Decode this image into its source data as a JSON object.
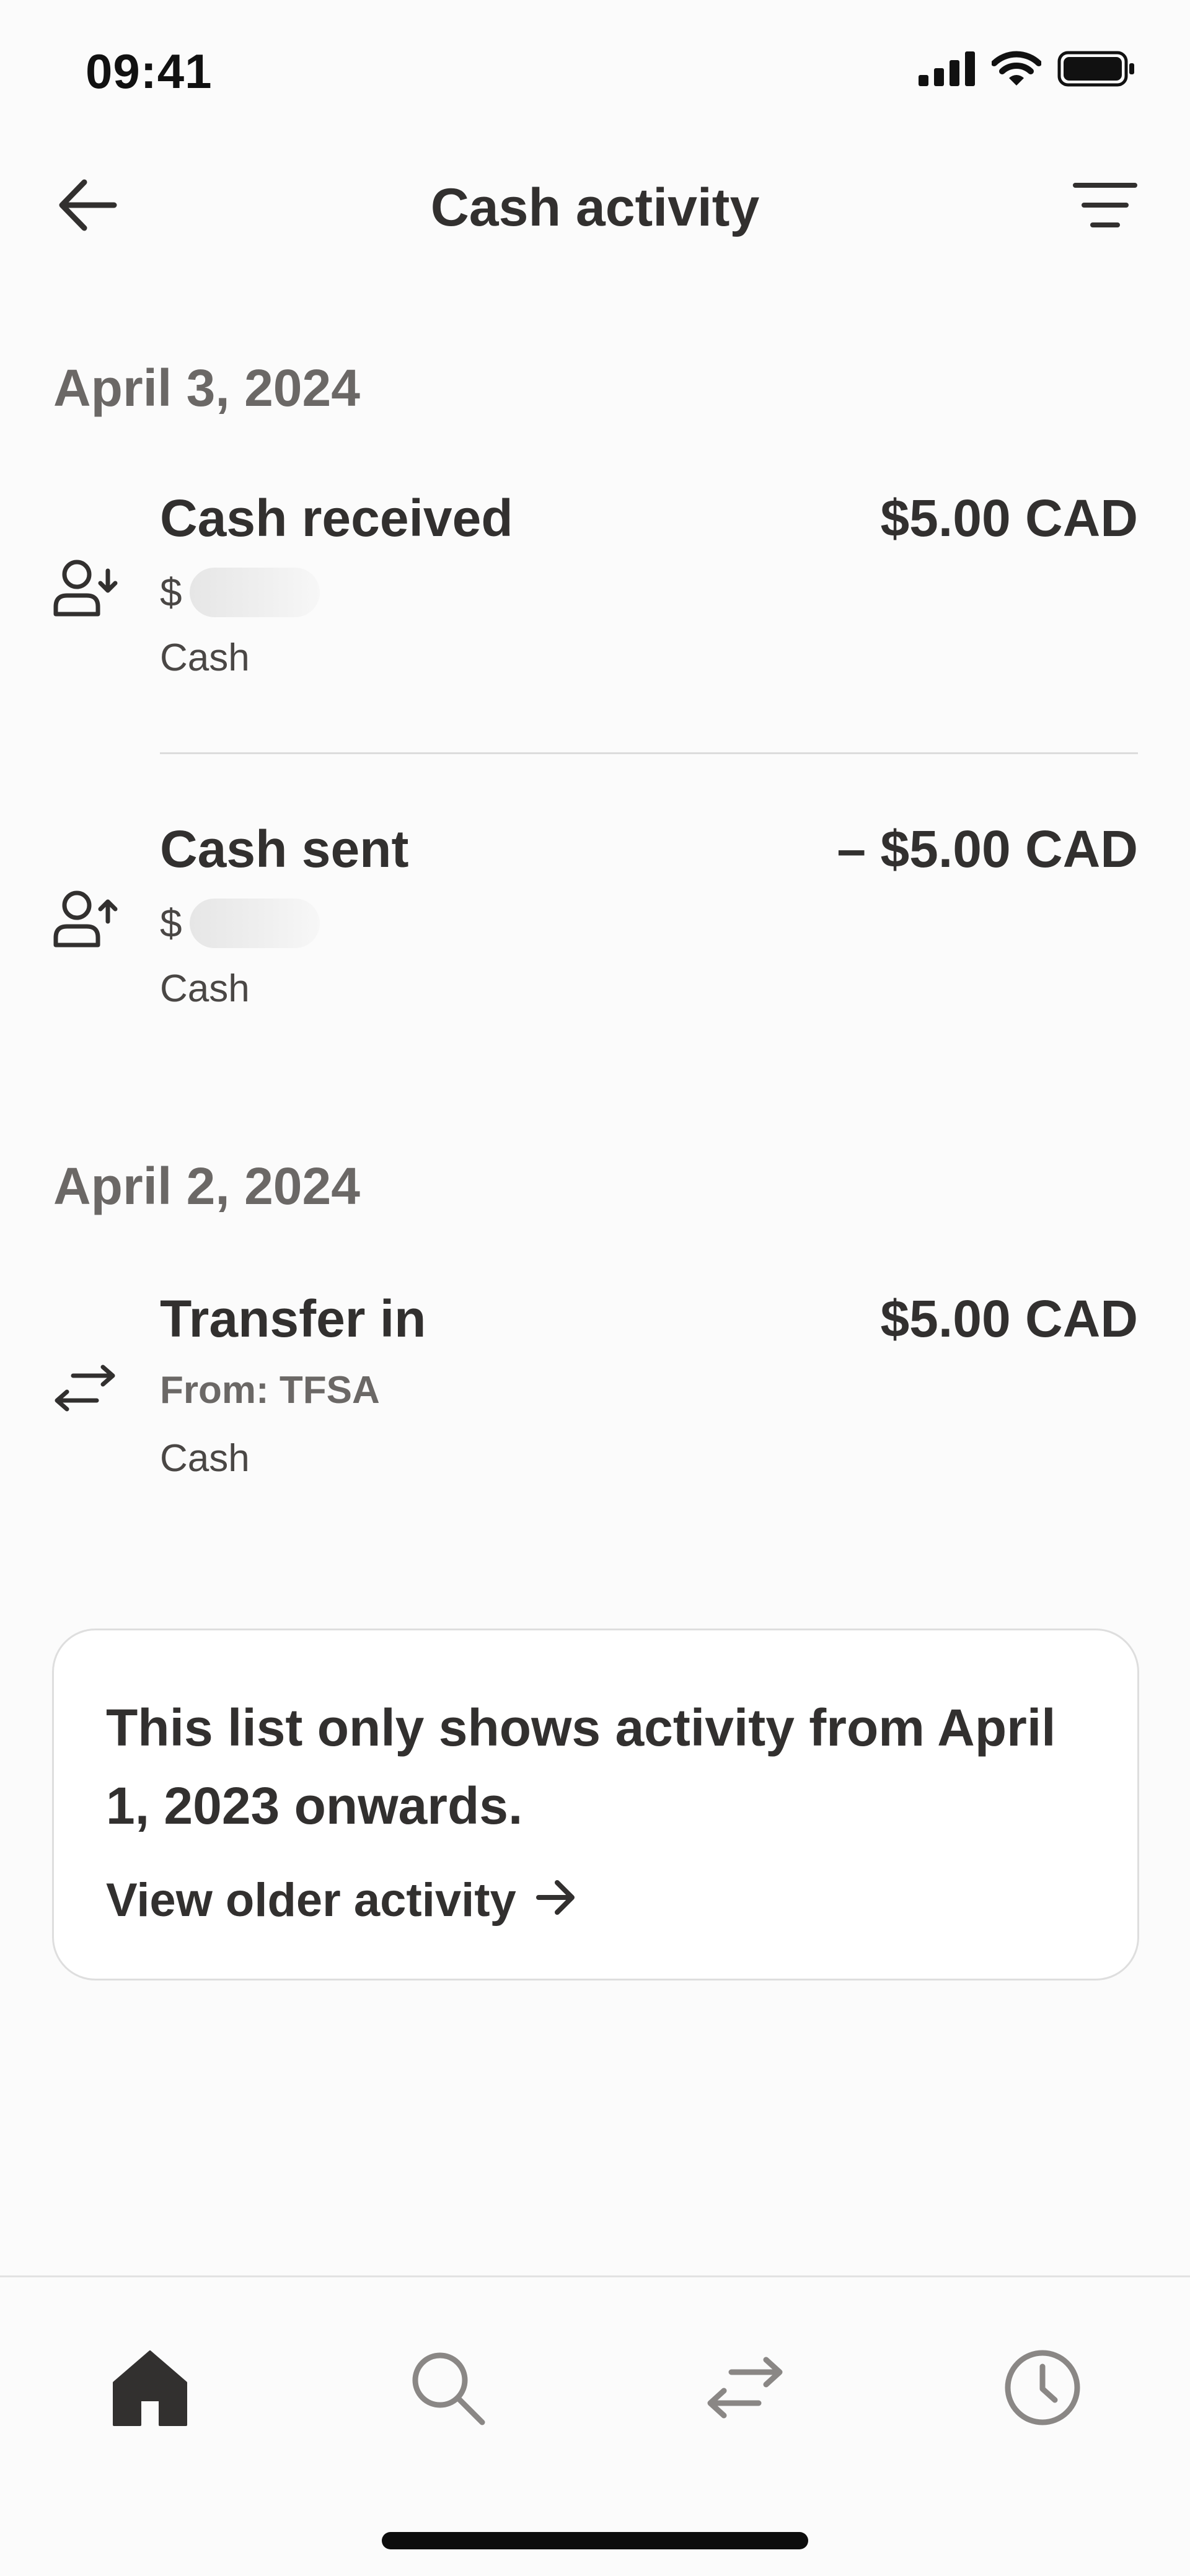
{
  "status_bar": {
    "time": "09:41",
    "icons": [
      "signal-icon",
      "wifi-icon",
      "battery-icon"
    ]
  },
  "header": {
    "title": "Cash activity",
    "back_icon": "arrow-left-icon",
    "filter_icon": "filter-icon"
  },
  "groups": [
    {
      "date": "April 3, 2024",
      "items": [
        {
          "title": "Cash received",
          "amount": "$5.00 CAD",
          "sub": "$",
          "type": "Cash",
          "icon": "person-receive-icon"
        },
        {
          "title": "Cash sent",
          "amount": "– $5.00 CAD",
          "sub": "$",
          "type": "Cash",
          "icon": "person-send-icon"
        }
      ]
    },
    {
      "date": "April 2, 2024",
      "items": [
        {
          "title": "Transfer in",
          "amount": "$5.00 CAD",
          "sub": "From: TFSA",
          "type": "Cash",
          "icon": "transfer-arrows-icon"
        }
      ]
    }
  ],
  "info_card": {
    "text": "This list only shows activity from April 1, 2023 onwards.",
    "link": "View older activity"
  },
  "bottom_nav": {
    "items": [
      "home-icon",
      "search-icon",
      "transfer-icon",
      "clock-icon"
    ],
    "active": "home-icon"
  },
  "colors": {
    "text": "#32302f",
    "muted": "#6b6866",
    "background": "#fbfbfb",
    "inactive_icon": "#8a8785"
  }
}
